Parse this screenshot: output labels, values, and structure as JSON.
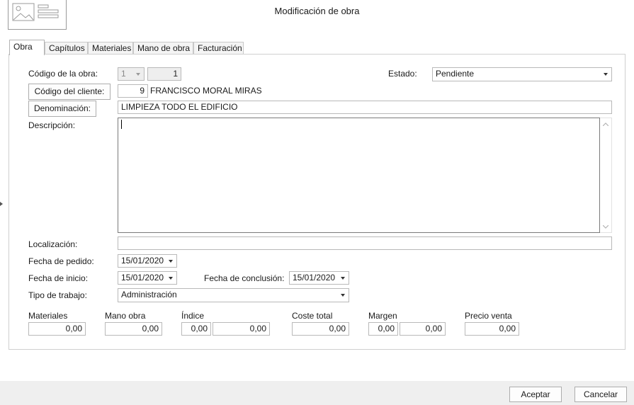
{
  "window": {
    "title": "Modificación de obra"
  },
  "tabs": [
    "Obra",
    "Capítulos",
    "Materiales",
    "Mano de obra",
    "Facturación"
  ],
  "form": {
    "codigo_obra": {
      "label": "Código de la obra:",
      "serie": "1",
      "numero": "1"
    },
    "estado": {
      "label": "Estado:",
      "value": "Pendiente"
    },
    "cliente": {
      "label": "Código del cliente:",
      "codigo": "9",
      "nombre": "FRANCISCO MORAL MIRAS"
    },
    "denominacion": {
      "label": "Denominación:",
      "value": "LIMPIEZA TODO EL EDIFICIO"
    },
    "descripcion": {
      "label": "Descripción:",
      "value": ""
    },
    "localizacion": {
      "label": "Localización:",
      "value": ""
    },
    "fecha_pedido": {
      "label": "Fecha de pedido:",
      "value": "15/01/2020"
    },
    "fecha_inicio": {
      "label": "Fecha de inicio:",
      "value": "15/01/2020"
    },
    "fecha_conclusion": {
      "label": "Fecha de conclusión:",
      "value": "15/01/2020"
    },
    "tipo_trabajo": {
      "label": "Tipo de trabajo:",
      "value": "Administración"
    }
  },
  "totals": {
    "materiales": {
      "label": "Materiales",
      "value": "0,00"
    },
    "mano_obra": {
      "label": "Mano obra",
      "value": "0,00"
    },
    "indice": {
      "label": "Índice",
      "value1": "0,00",
      "value2": "0,00"
    },
    "coste_total": {
      "label": "Coste total",
      "value": "0,00"
    },
    "margen": {
      "label": "Margen",
      "value1": "0,00",
      "value2": "0,00"
    },
    "precio_venta": {
      "label": "Precio venta",
      "value": "0,00"
    }
  },
  "buttons": {
    "accept": "Aceptar",
    "cancel": "Cancelar"
  },
  "icons": {
    "logo": "image-placeholder-icon",
    "dropdown": "chevron-down-icon"
  }
}
